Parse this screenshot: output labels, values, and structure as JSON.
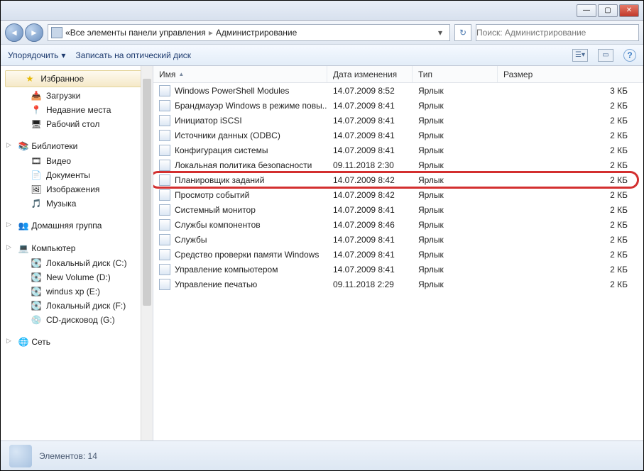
{
  "window": {
    "min": "—",
    "max": "▢",
    "close": "✕"
  },
  "nav": {
    "back": "◄",
    "forward": "►",
    "path_prefix": "«",
    "path_seg1": "Все элементы панели управления",
    "path_seg2": "Администрирование",
    "sep": "▸",
    "dropdown": "▾"
  },
  "search": {
    "placeholder": "Поиск: Администрирование"
  },
  "toolbar": {
    "organize": "Упорядочить",
    "burn": "Записать на оптический диск",
    "view_icon": "☰",
    "preview_icon": "▭",
    "help": "?"
  },
  "sidebar": {
    "fav": "Избранное",
    "fav_items": [
      {
        "icon": "📥",
        "label": "Загрузки"
      },
      {
        "icon": "📍",
        "label": "Недавние места"
      },
      {
        "icon": "🖥",
        "label": "Рабочий стол"
      }
    ],
    "lib": "Библиотеки",
    "lib_items": [
      {
        "icon": "🎞",
        "label": "Видео"
      },
      {
        "icon": "📄",
        "label": "Документы"
      },
      {
        "icon": "🖼",
        "label": "Изображения"
      },
      {
        "icon": "🎵",
        "label": "Музыка"
      }
    ],
    "homegroup": "Домашняя группа",
    "computer": "Компьютер",
    "computer_items": [
      {
        "icon": "💽",
        "label": "Локальный диск (C:)"
      },
      {
        "icon": "💽",
        "label": "New Volume (D:)"
      },
      {
        "icon": "💽",
        "label": "windus xp (E:)"
      },
      {
        "icon": "💽",
        "label": "Локальный диск (F:)"
      },
      {
        "icon": "💿",
        "label": "CD-дисковод (G:)"
      }
    ],
    "network": "Сеть"
  },
  "columns": {
    "name": "Имя",
    "date": "Дата изменения",
    "type": "Тип",
    "size": "Размер"
  },
  "files": [
    {
      "name": "Windows PowerShell Modules",
      "date": "14.07.2009 8:52",
      "type": "Ярлык",
      "size": "3 КБ",
      "hl": false
    },
    {
      "name": "Брандмауэр Windows в режиме повы...",
      "date": "14.07.2009 8:41",
      "type": "Ярлык",
      "size": "2 КБ",
      "hl": false
    },
    {
      "name": "Инициатор iSCSI",
      "date": "14.07.2009 8:41",
      "type": "Ярлык",
      "size": "2 КБ",
      "hl": false
    },
    {
      "name": "Источники данных (ODBC)",
      "date": "14.07.2009 8:41",
      "type": "Ярлык",
      "size": "2 КБ",
      "hl": false
    },
    {
      "name": "Конфигурация системы",
      "date": "14.07.2009 8:41",
      "type": "Ярлык",
      "size": "2 КБ",
      "hl": false
    },
    {
      "name": "Локальная политика безопасности",
      "date": "09.11.2018 2:30",
      "type": "Ярлык",
      "size": "2 КБ",
      "hl": false
    },
    {
      "name": "Планировщик заданий",
      "date": "14.07.2009 8:42",
      "type": "Ярлык",
      "size": "2 КБ",
      "hl": true
    },
    {
      "name": "Просмотр событий",
      "date": "14.07.2009 8:42",
      "type": "Ярлык",
      "size": "2 КБ",
      "hl": false
    },
    {
      "name": "Системный монитор",
      "date": "14.07.2009 8:41",
      "type": "Ярлык",
      "size": "2 КБ",
      "hl": false
    },
    {
      "name": "Службы компонентов",
      "date": "14.07.2009 8:46",
      "type": "Ярлык",
      "size": "2 КБ",
      "hl": false
    },
    {
      "name": "Службы",
      "date": "14.07.2009 8:41",
      "type": "Ярлык",
      "size": "2 КБ",
      "hl": false
    },
    {
      "name": "Средство проверки памяти Windows",
      "date": "14.07.2009 8:41",
      "type": "Ярлык",
      "size": "2 КБ",
      "hl": false
    },
    {
      "name": "Управление компьютером",
      "date": "14.07.2009 8:41",
      "type": "Ярлык",
      "size": "2 КБ",
      "hl": false
    },
    {
      "name": "Управление печатью",
      "date": "09.11.2018 2:29",
      "type": "Ярлык",
      "size": "2 КБ",
      "hl": false
    }
  ],
  "status": {
    "count": "Элементов: 14"
  },
  "icons": {
    "star": "★",
    "homegroup": "👥",
    "computer": "💻",
    "network": "🌐",
    "lib": "📚"
  }
}
